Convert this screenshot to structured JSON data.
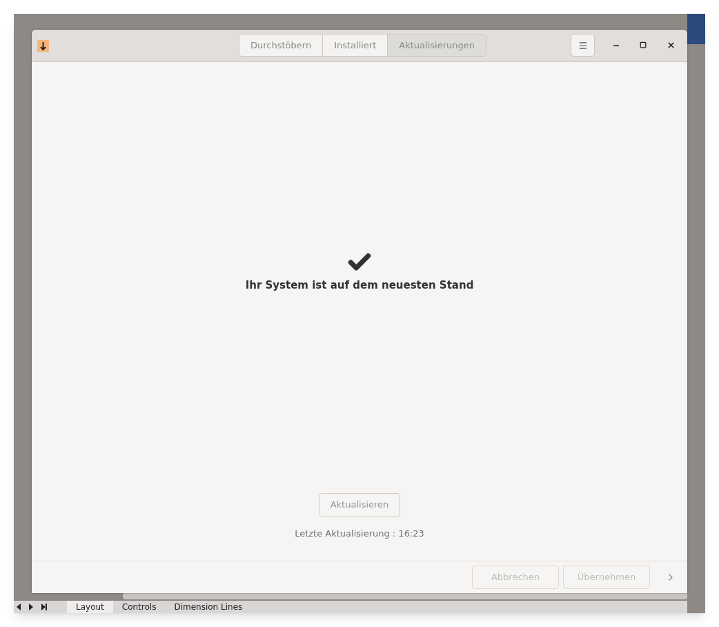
{
  "header": {
    "view_tabs": [
      {
        "label": "Durchstöbern",
        "selected": false
      },
      {
        "label": "Installiert",
        "selected": false
      },
      {
        "label": "Aktualisierungen",
        "selected": true
      }
    ]
  },
  "status": {
    "message": "Ihr System ist auf dem neuesten Stand"
  },
  "update_button": {
    "label": "Aktualisieren",
    "disabled": true
  },
  "last_update": "Letzte Aktualisierung : 16:23",
  "footer": {
    "buttons": [
      {
        "label": "Abbrechen",
        "disabled": true
      },
      {
        "label": "Übernehmen",
        "disabled": true
      }
    ]
  },
  "sheet_tabs": [
    {
      "label": "Layout",
      "selected": true
    },
    {
      "label": "Controls",
      "selected": false
    },
    {
      "label": "Dimension Lines",
      "selected": false
    }
  ]
}
